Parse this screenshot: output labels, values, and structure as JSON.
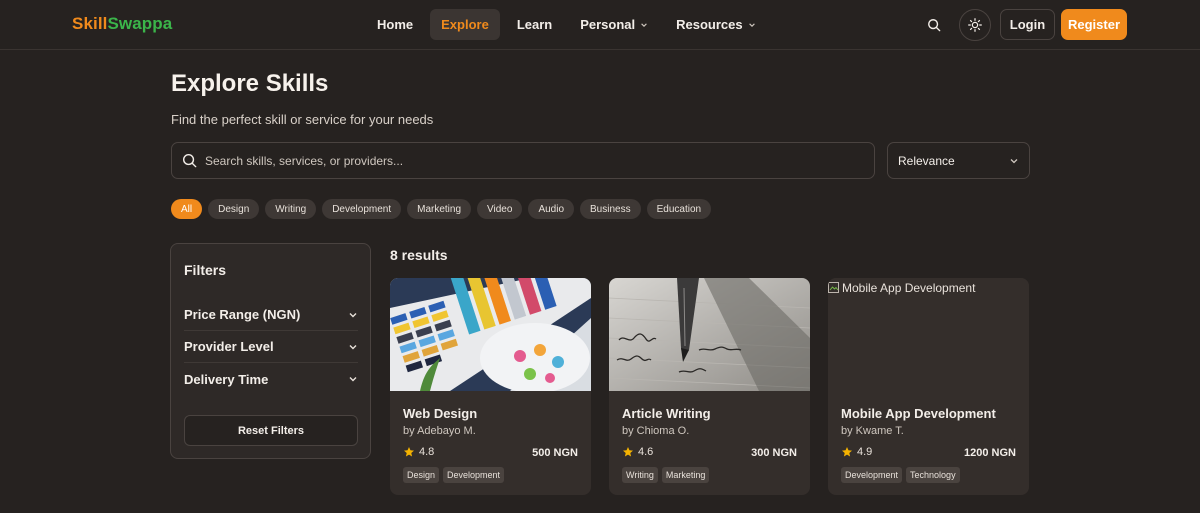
{
  "brand": {
    "part1": "Skill",
    "part2": "Swappa"
  },
  "nav": {
    "items": [
      {
        "label": "Home"
      },
      {
        "label": "Explore"
      },
      {
        "label": "Learn"
      },
      {
        "label": "Personal"
      },
      {
        "label": "Resources"
      }
    ],
    "active": "Explore"
  },
  "auth": {
    "login": "Login",
    "register": "Register"
  },
  "header": {
    "title": "Explore Skills",
    "subtitle": "Find the perfect skill or service for your needs"
  },
  "search": {
    "placeholder": "Search skills, services, or providers...",
    "value": ""
  },
  "sort": {
    "selected": "Relevance"
  },
  "categories": [
    "All",
    "Design",
    "Writing",
    "Development",
    "Marketing",
    "Video",
    "Audio",
    "Business",
    "Education"
  ],
  "filters": {
    "title": "Filters",
    "groups": [
      "Price Range (NGN)",
      "Provider Level",
      "Delivery Time"
    ],
    "reset": "Reset Filters"
  },
  "results": {
    "count_text": "8 results",
    "items": [
      {
        "title": "Web Design",
        "provider": "by Adebayo M.",
        "rating": "4.8",
        "price": "500 NGN",
        "tags": [
          "Design",
          "Development"
        ]
      },
      {
        "title": "Article Writing",
        "provider": "by Chioma O.",
        "rating": "4.6",
        "price": "300 NGN",
        "tags": [
          "Writing",
          "Marketing"
        ]
      },
      {
        "title": "Mobile App Development",
        "provider": "by Kwame T.",
        "rating": "4.9",
        "price": "1200 NGN",
        "tags": [
          "Development",
          "Technology"
        ],
        "image_alt": "Mobile App Development"
      }
    ]
  },
  "colors": {
    "accent": "#f08a1c",
    "brand_green": "#3bb54a",
    "background": "#262220",
    "card": "#342e2b",
    "star": "#f5b301"
  }
}
